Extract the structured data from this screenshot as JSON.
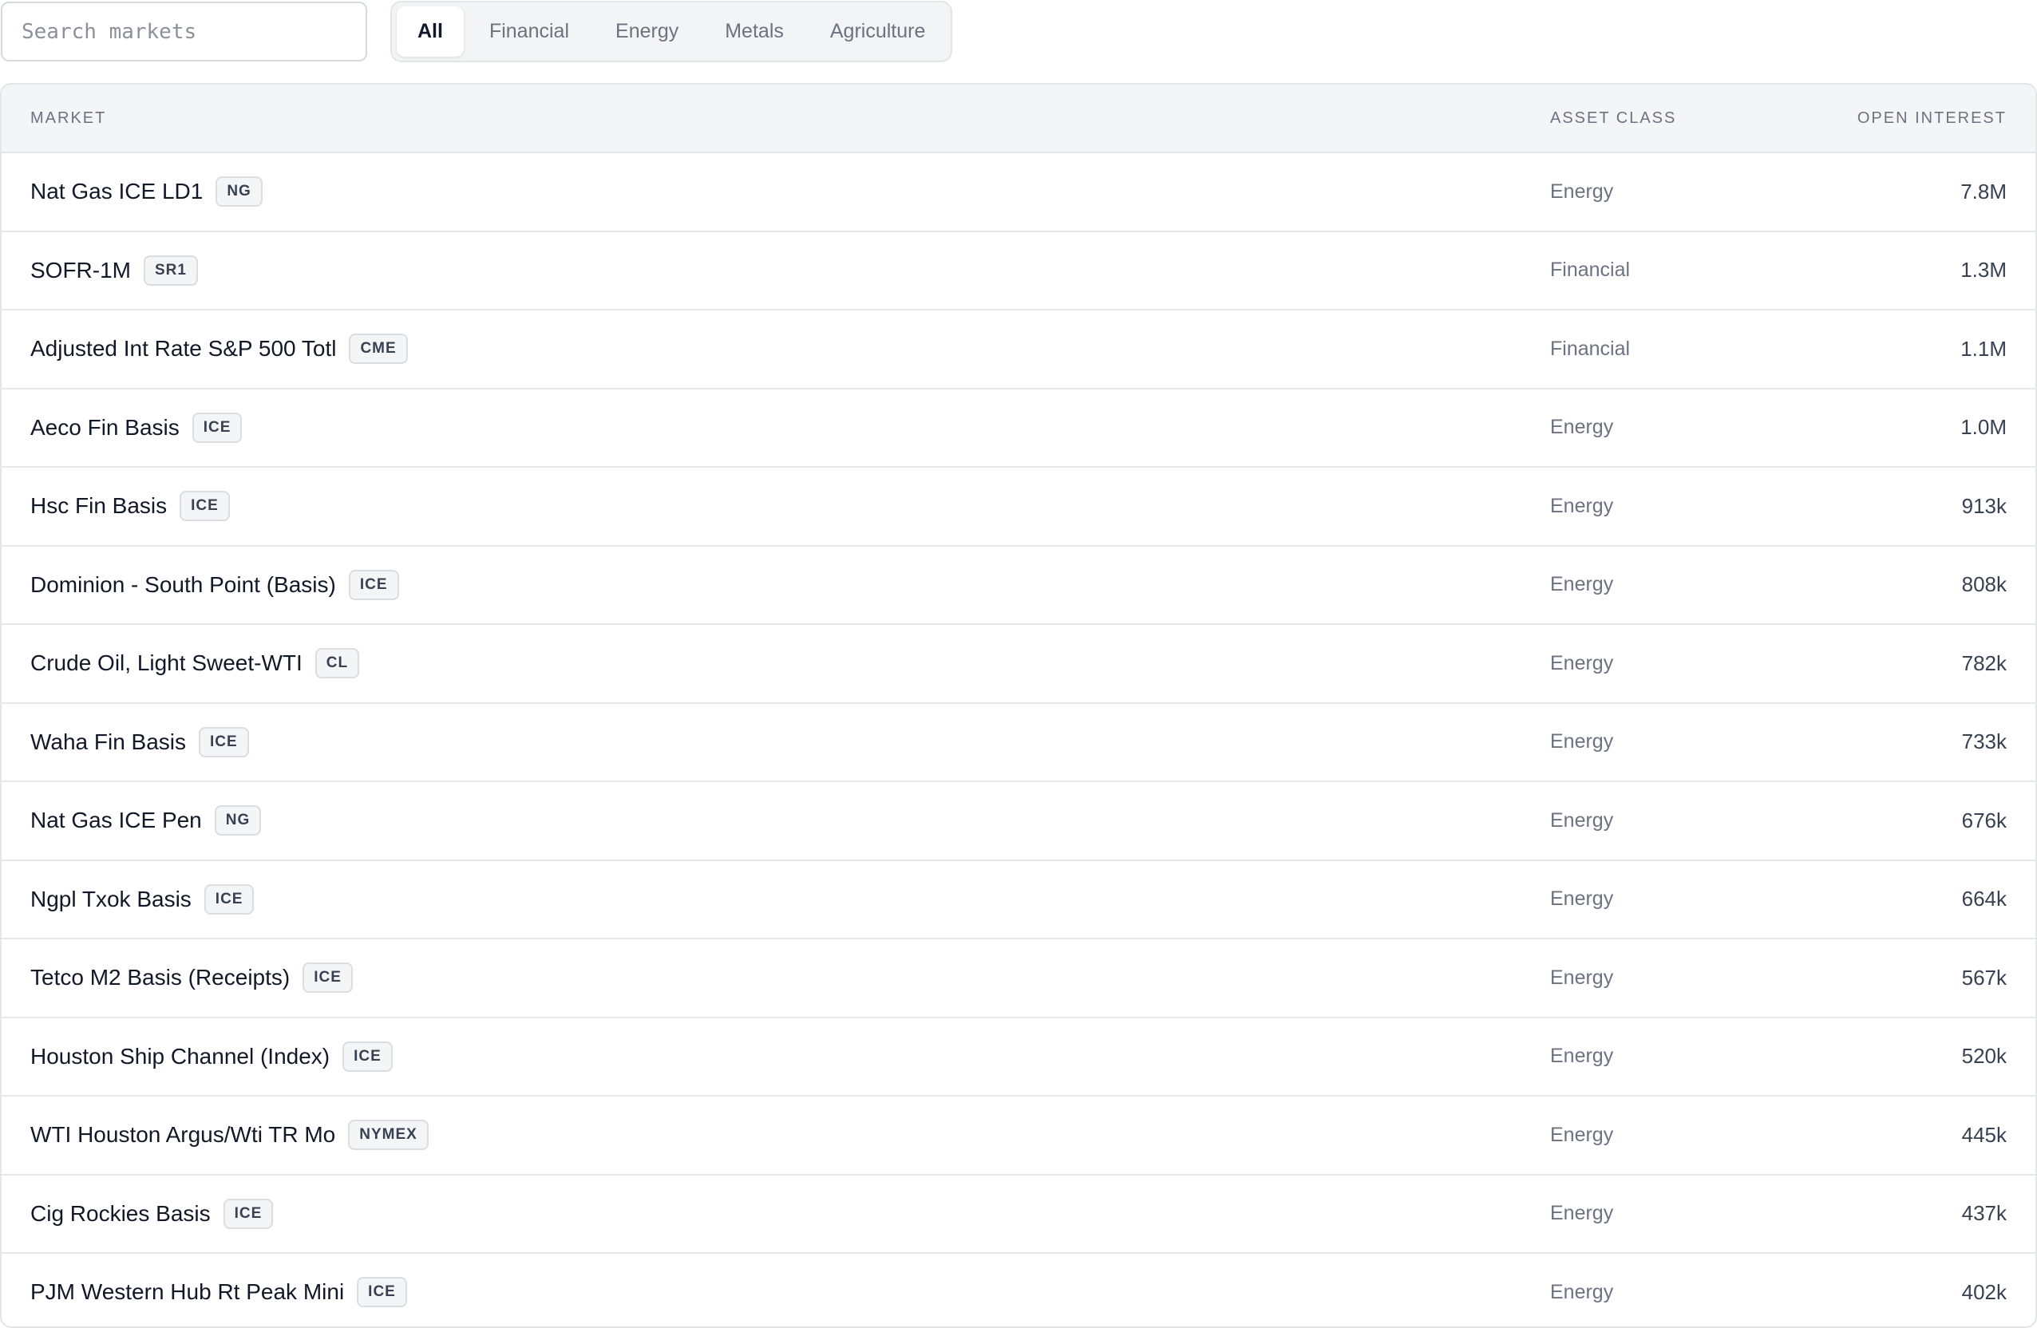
{
  "search": {
    "placeholder": "Search markets",
    "value": ""
  },
  "filters": [
    {
      "label": "All",
      "active": true
    },
    {
      "label": "Financial",
      "active": false
    },
    {
      "label": "Energy",
      "active": false
    },
    {
      "label": "Metals",
      "active": false
    },
    {
      "label": "Agriculture",
      "active": false
    }
  ],
  "table": {
    "headers": {
      "market": "MARKET",
      "asset_class": "ASSET CLASS",
      "open_interest": "OPEN INTEREST"
    },
    "rows": [
      {
        "market": "Nat Gas ICE LD1",
        "badge": "NG",
        "asset_class": "Energy",
        "open_interest": "7.8M"
      },
      {
        "market": "SOFR-1M",
        "badge": "SR1",
        "asset_class": "Financial",
        "open_interest": "1.3M"
      },
      {
        "market": "Adjusted Int Rate S&P 500 Totl",
        "badge": "CME",
        "asset_class": "Financial",
        "open_interest": "1.1M"
      },
      {
        "market": "Aeco Fin Basis",
        "badge": "ICE",
        "asset_class": "Energy",
        "open_interest": "1.0M"
      },
      {
        "market": "Hsc Fin Basis",
        "badge": "ICE",
        "asset_class": "Energy",
        "open_interest": "913k"
      },
      {
        "market": "Dominion - South Point (Basis)",
        "badge": "ICE",
        "asset_class": "Energy",
        "open_interest": "808k"
      },
      {
        "market": "Crude Oil, Light Sweet-WTI",
        "badge": "CL",
        "asset_class": "Energy",
        "open_interest": "782k"
      },
      {
        "market": "Waha Fin Basis",
        "badge": "ICE",
        "asset_class": "Energy",
        "open_interest": "733k"
      },
      {
        "market": "Nat Gas ICE Pen",
        "badge": "NG",
        "asset_class": "Energy",
        "open_interest": "676k"
      },
      {
        "market": "Ngpl Txok Basis",
        "badge": "ICE",
        "asset_class": "Energy",
        "open_interest": "664k"
      },
      {
        "market": "Tetco M2 Basis (Receipts)",
        "badge": "ICE",
        "asset_class": "Energy",
        "open_interest": "567k"
      },
      {
        "market": "Houston Ship Channel (Index)",
        "badge": "ICE",
        "asset_class": "Energy",
        "open_interest": "520k"
      },
      {
        "market": "WTI Houston Argus/Wti TR Mo",
        "badge": "NYMEX",
        "asset_class": "Energy",
        "open_interest": "445k"
      },
      {
        "market": "Cig Rockies Basis",
        "badge": "ICE",
        "asset_class": "Energy",
        "open_interest": "437k"
      },
      {
        "market": "PJM Western Hub Rt Peak Mini",
        "badge": "ICE",
        "asset_class": "Energy",
        "open_interest": "402k"
      }
    ]
  }
}
